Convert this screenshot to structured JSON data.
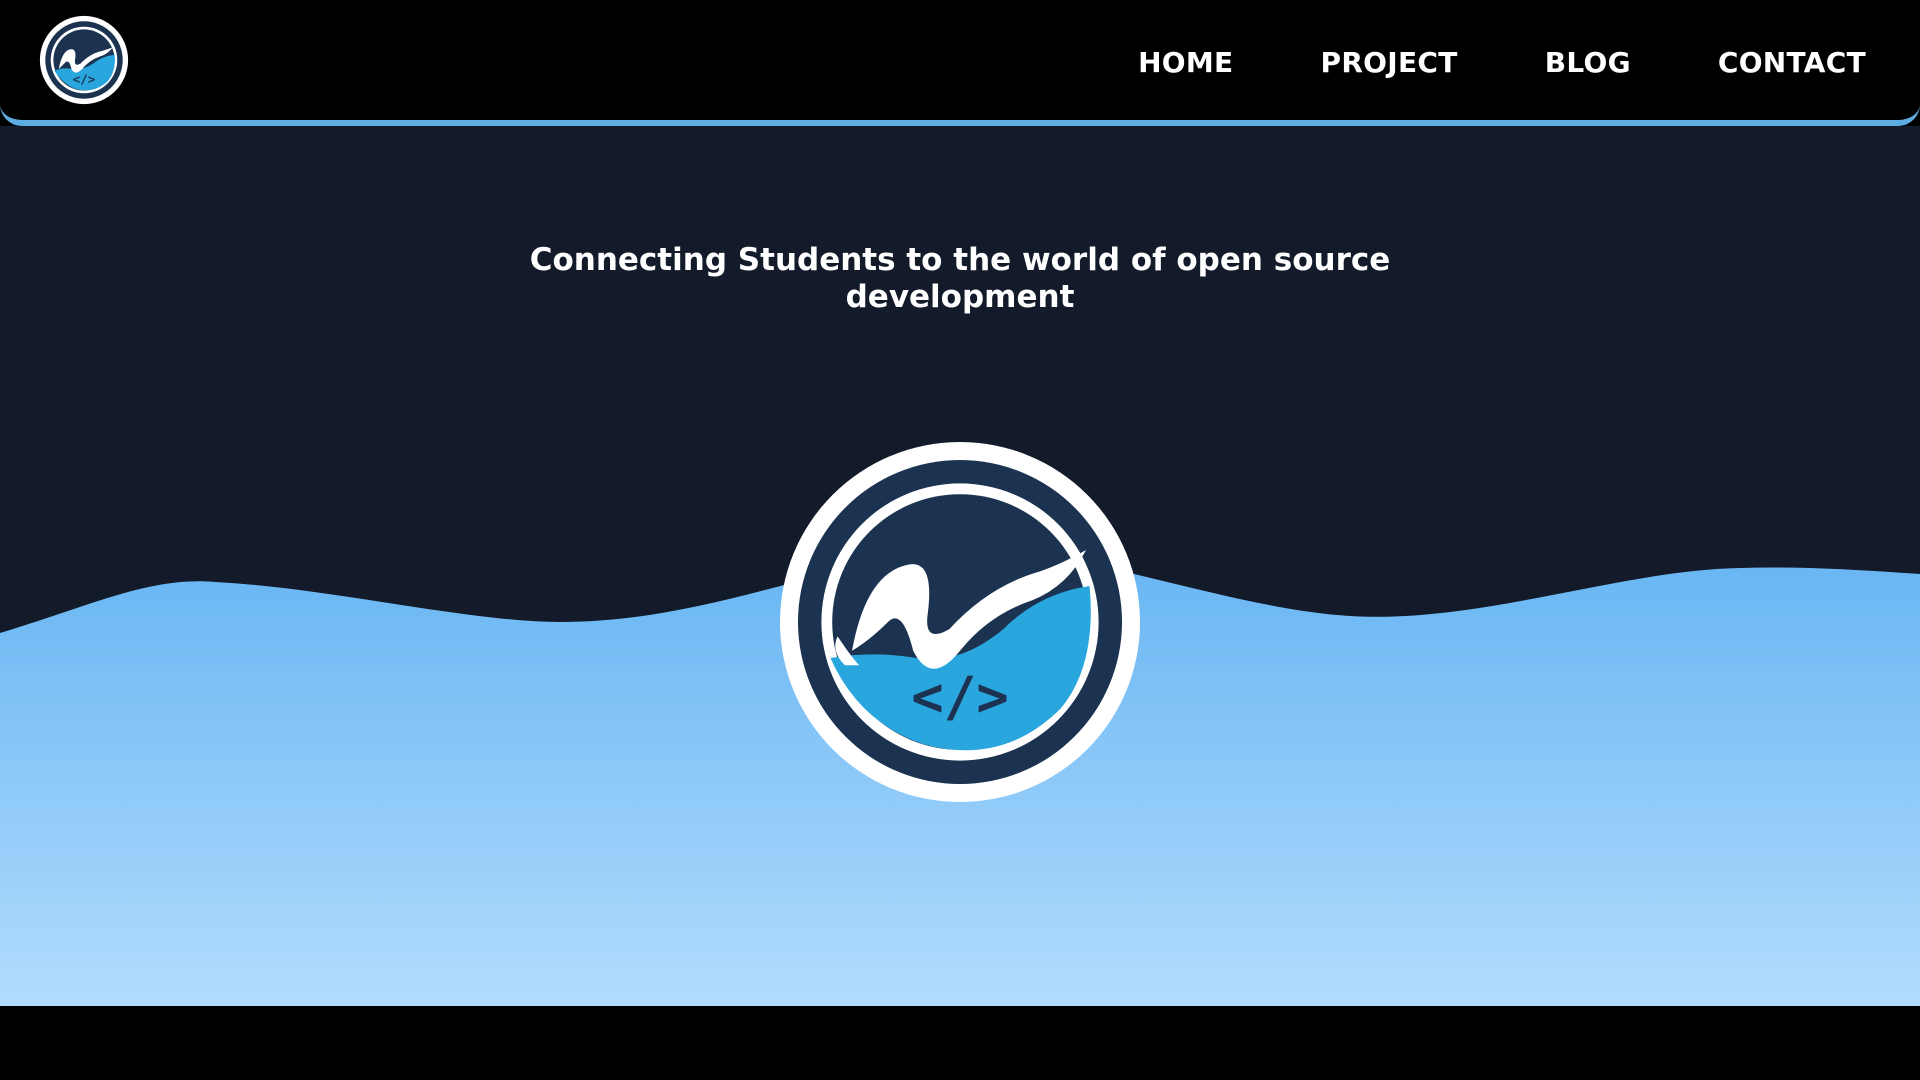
{
  "nav": {
    "logo_icon": "brand-logo-icon",
    "links": [
      {
        "label": "HOME"
      },
      {
        "label": "PROJECT"
      },
      {
        "label": "BLOG"
      },
      {
        "label": "CONTACT"
      }
    ]
  },
  "hero": {
    "title_line1": "Connecting Students to the world of open source",
    "title_line2": "development",
    "logo_icon": "brand-logo-icon"
  },
  "colors": {
    "navbar_bg": "#000000",
    "navbar_border": "#5dade2",
    "hero_bg": "#131a2a",
    "wave_top": "#66b5f3",
    "wave_bottom": "#b3dcfd",
    "logo_dark": "#1b3250",
    "logo_light": "#2aa6df"
  }
}
